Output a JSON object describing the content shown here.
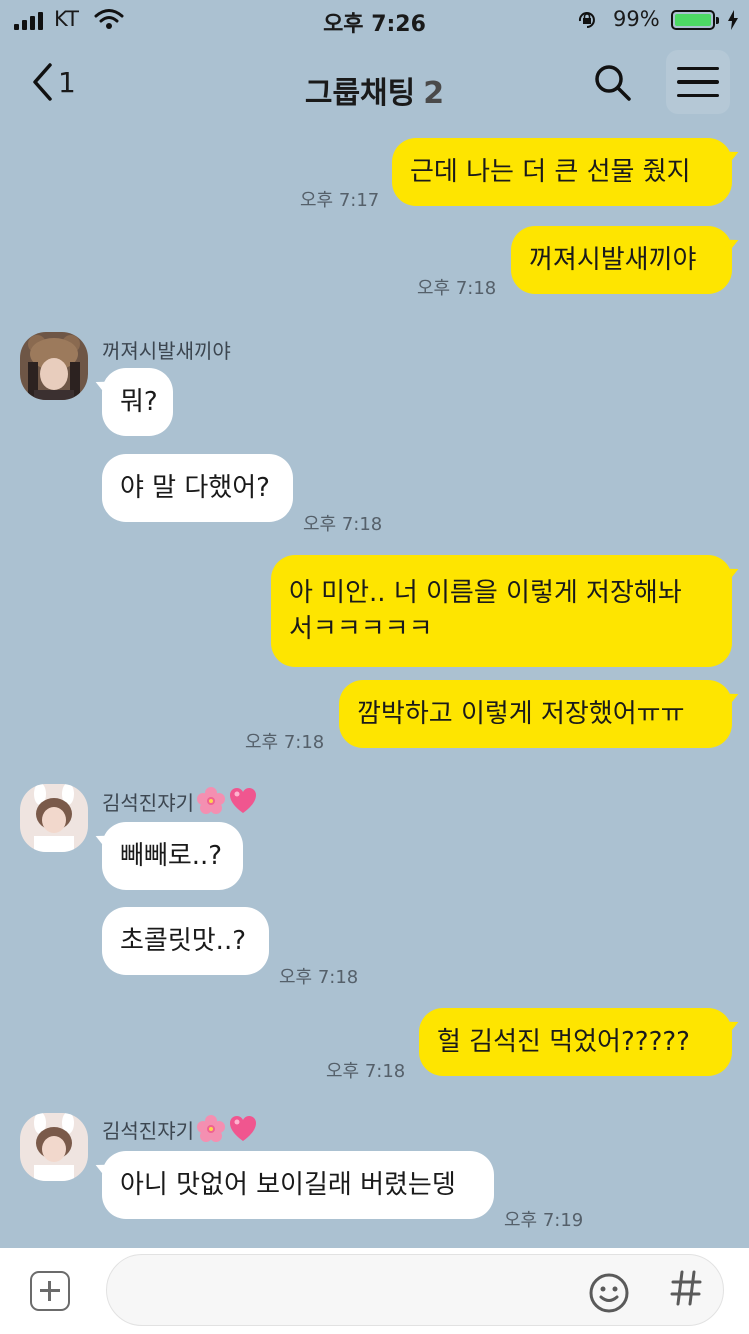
{
  "status_bar": {
    "carrier": "KT",
    "time": "오후 7:26",
    "battery_percent": "99%",
    "battery_level": 0.99
  },
  "header": {
    "back_count": "1",
    "title": "그룹채팅",
    "member_count": "2"
  },
  "messages": [
    {
      "direction": "out",
      "text": "근데 나는 더 큰 선물 줬지",
      "time": "오후 7:17"
    },
    {
      "direction": "out",
      "text": "꺼져시발새끼야",
      "time": "오후 7:18"
    },
    {
      "direction": "in",
      "sender": "꺼져시발새끼야",
      "text": "뭐?"
    },
    {
      "direction": "in",
      "text": "야 말 다했어?",
      "time": "오후 7:18"
    },
    {
      "direction": "out",
      "lines": [
        "아 미안.. 너 이름을 이렇게 저장해놔",
        "서ㅋㅋㅋㅋㅋ"
      ]
    },
    {
      "direction": "out",
      "text": "깜박하고 이렇게 저장했어ㅠㅠ",
      "time": "오후 7:18"
    },
    {
      "direction": "in",
      "sender": "김석진쟈기",
      "text": "빼빼로..?"
    },
    {
      "direction": "in",
      "text": "초콜릿맛..?",
      "time": "오후 7:18"
    },
    {
      "direction": "out",
      "text": "헐 김석진 먹었어?????",
      "time": "오후 7:18"
    },
    {
      "direction": "in",
      "sender": "김석진쟈기",
      "text": "아니 맛없어 보이길래 버렸는뎅",
      "time": "오후 7:19"
    }
  ],
  "colors": {
    "background": "#abc1d1",
    "outgoing_bubble": "#fee500",
    "incoming_bubble": "#ffffff",
    "battery_fill": "#4cd964"
  },
  "icons": [
    "back-chevron-icon",
    "search-icon",
    "menu-icon",
    "plus-icon",
    "emoji-icon",
    "hashtag-icon",
    "cherry-blossom-emoji",
    "pink-heart-emoji"
  ]
}
